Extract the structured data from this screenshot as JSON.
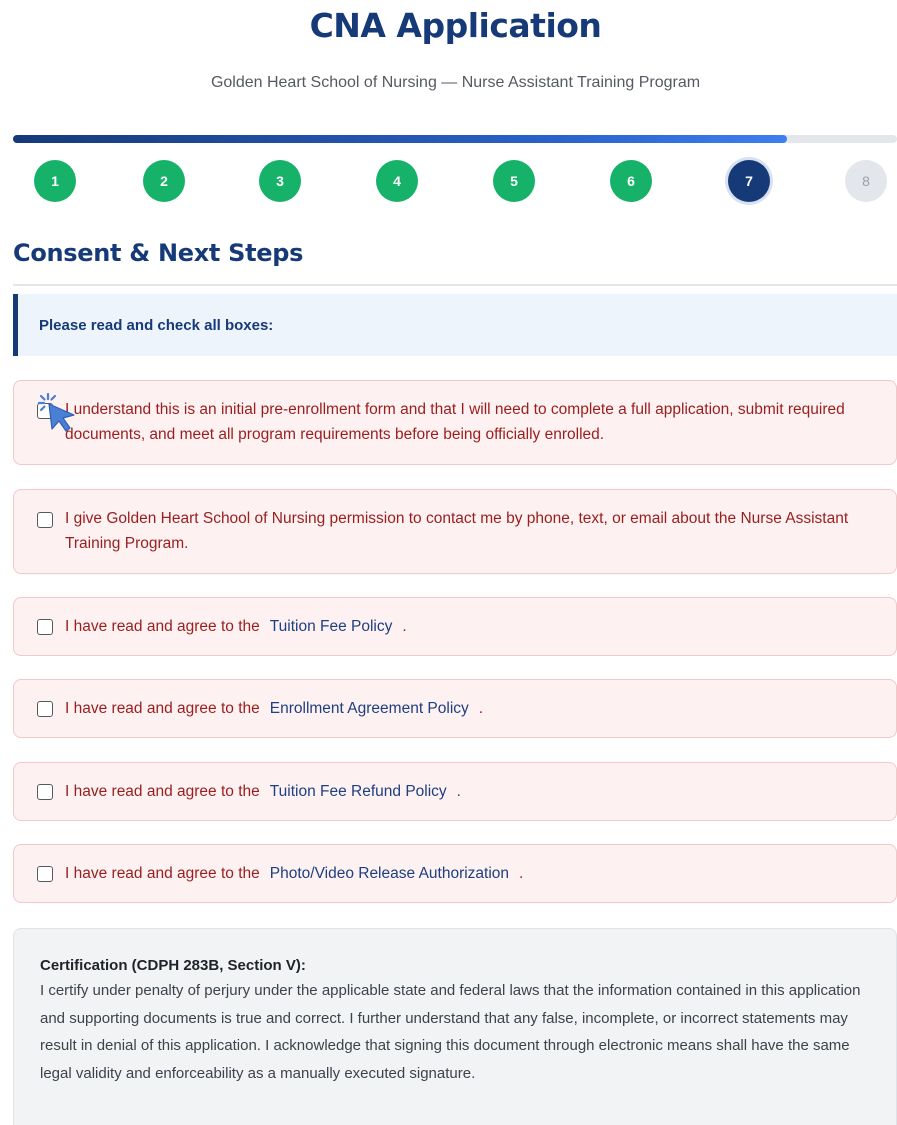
{
  "header": {
    "title": "CNA Application",
    "subtitle": "Golden Heart School of Nursing — Nurse Assistant Training Program"
  },
  "progress": {
    "fraction": 0.875,
    "steps": [
      {
        "label": "1",
        "state": "done"
      },
      {
        "label": "2",
        "state": "done"
      },
      {
        "label": "3",
        "state": "done"
      },
      {
        "label": "4",
        "state": "done"
      },
      {
        "label": "5",
        "state": "done"
      },
      {
        "label": "6",
        "state": "done"
      },
      {
        "label": "7",
        "state": "current"
      },
      {
        "label": "8",
        "state": "todo"
      }
    ]
  },
  "section": {
    "title": "Consent & Next Steps",
    "instruction": "Please read and check all boxes:"
  },
  "consents": {
    "pre_enrollment": "I understand this is an initial pre-enrollment form and that I will need to complete a full application, submit required documents, and meet all program requirements before being officially enrolled.",
    "contact_permission": "I give Golden Heart School of Nursing permission to contact me by phone, text, or email about the Nurse Assistant Training Program.",
    "agree_prefix": "I have read and agree to the",
    "agree_suffix": ".",
    "tuition_fee_policy": "Tuition Fee Policy",
    "enrollment_agreement_policy": "Enrollment Agreement Policy",
    "tuition_refund_policy": "Tuition Fee Refund Policy",
    "photo_video_release": "Photo/Video Release Authorization"
  },
  "certification": {
    "title": "Certification (CDPH 283B, Section V):",
    "body": "I certify under penalty of perjury under the applicable state and federal laws that the information contained in this application and supporting documents is true and correct. I further understand that any false, incomplete, or incorrect statements may result in denial of this application. I acknowledge that signing this document through electronic means shall have the same legal validity and enforceability as a manually executed signature."
  },
  "colors": {
    "primary": "#163a78",
    "complete": "#17b26a",
    "consent_text": "#9a1e1e",
    "consent_bg": "#fdf1f1",
    "link": "#1e3f80"
  },
  "icons": {
    "cursor": "hand-pointer-click-icon"
  }
}
